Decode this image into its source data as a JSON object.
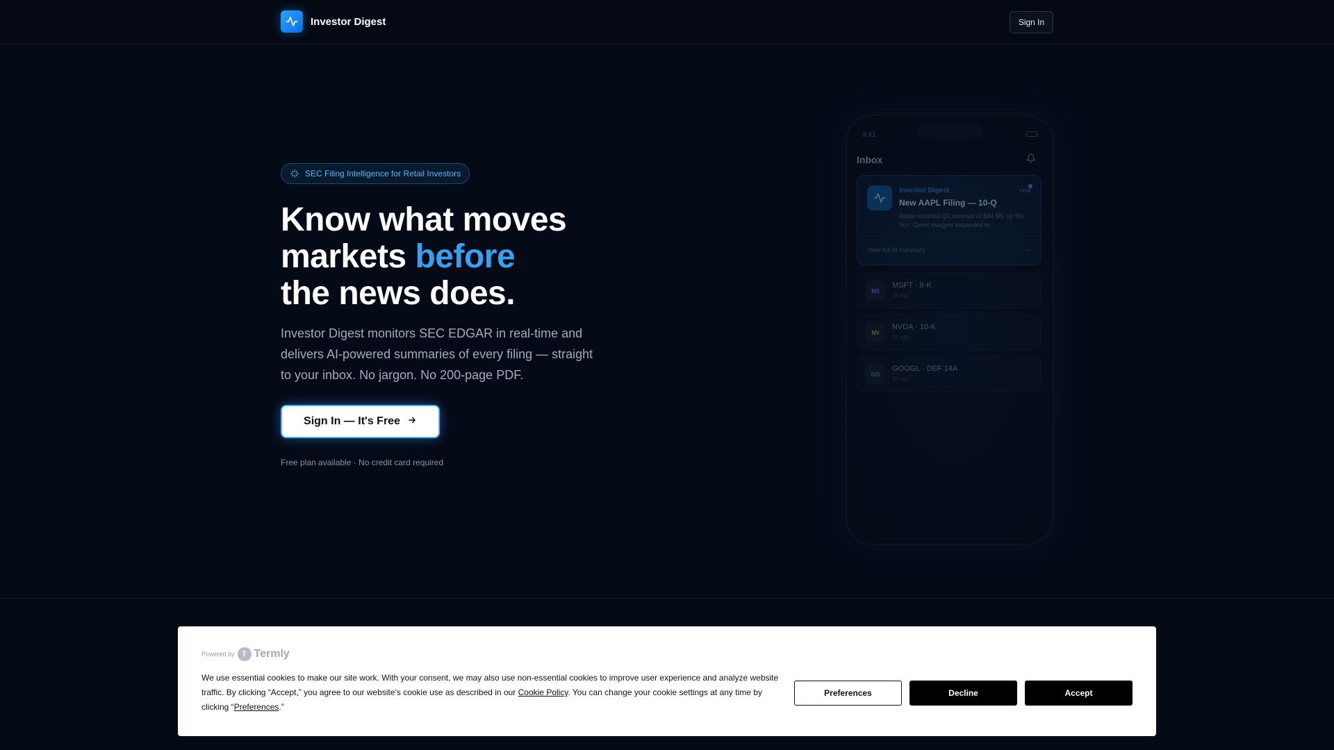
{
  "header": {
    "brand": "Investor Digest",
    "sign_in": "Sign In"
  },
  "hero": {
    "badge": "SEC Filing Intelligence for Retail Investors",
    "headline_1": "Know what moves",
    "headline_2a": "markets",
    "headline_2b": "before",
    "headline_3": "the news does.",
    "subtitle": "Investor Digest monitors SEC EDGAR in real-time and delivers AI-powered summaries of every filing — straight to your inbox. No jargon. No 200-page PDF.",
    "cta": "Sign In — It's Free",
    "fineprint": "Free plan available · No credit card required"
  },
  "phone": {
    "time": "9:41",
    "inbox_title": "Inbox",
    "notification": {
      "app": "Investor Digest",
      "time": "now",
      "title": "New AAPL Filing — 10-Q",
      "body": "Apple reported Q3 revenue of $94.9B, up 5% YoY. Gross margins expanded to…",
      "link": "View full AI summary"
    },
    "rows": [
      {
        "avatar": "MS",
        "title": "MSFT · 8-K",
        "time": "2h ago",
        "color": "#7a6fd0"
      },
      {
        "avatar": "NV",
        "title": "NVDA · 10-K",
        "time": "1d ago",
        "color": "#b8a020"
      },
      {
        "avatar": "GO",
        "title": "GOOGL · DEF 14A",
        "time": "3d ago",
        "color": "#2a9a6a"
      }
    ]
  },
  "cookie_banner": {
    "powered_by": "Powered by",
    "termly": "Termly",
    "text_1": "We use essential cookies to make our site work. With your consent, we may also use non-essential cookies to improve user experience and analyze website traffic. By clicking “Accept,” you agree to our website's cookie use as described in our ",
    "cookie_policy_link": "Cookie Policy",
    "text_2": ". You can change your cookie settings at any time by clicking “",
    "preferences_link": "Preferences",
    "text_3": ".”",
    "preferences_button": "Preferences",
    "decline_button": "Decline",
    "accept_button": "Accept"
  },
  "colors": {
    "background": "#050a17",
    "accent": "#3a9ff0",
    "brand_gradient_start": "#2ea1ff",
    "brand_gradient_end": "#0a6fe0"
  },
  "icons": [
    "activity-pulse-icon",
    "sparkle-icon",
    "arrow-right-icon",
    "bell-icon",
    "battery-icon"
  ]
}
